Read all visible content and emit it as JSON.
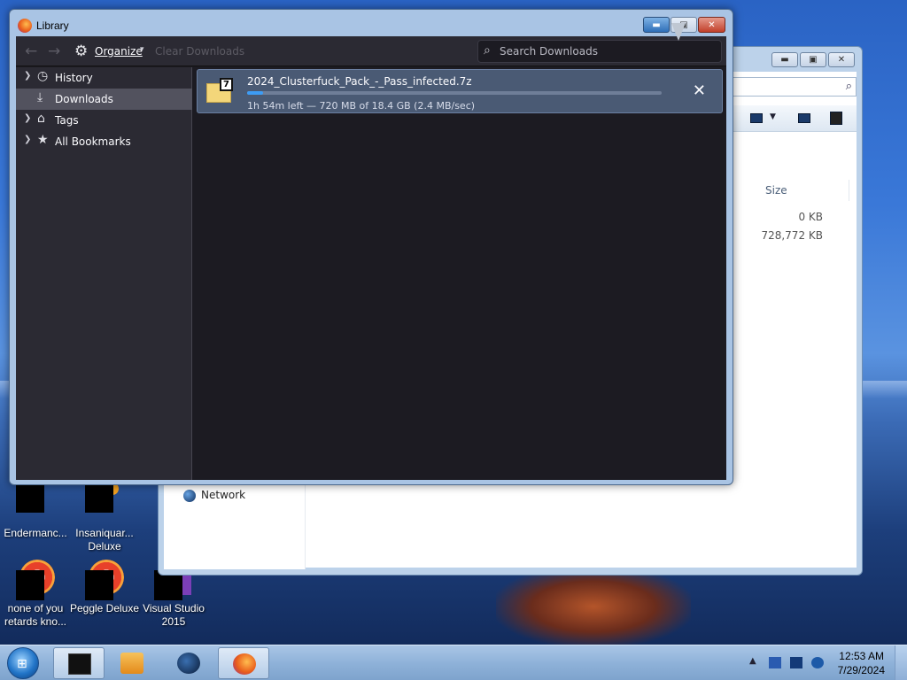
{
  "library": {
    "title": "Library",
    "toolbar": {
      "organize_label": "Organize",
      "clear_label": "Clear Downloads",
      "search_placeholder": "Search Downloads"
    },
    "sidebar": {
      "items": [
        {
          "label": "History",
          "icon": "clock-icon",
          "expandable": true,
          "selected": false
        },
        {
          "label": "Downloads",
          "icon": "download-icon",
          "expandable": false,
          "selected": true
        },
        {
          "label": "Tags",
          "icon": "tag-icon",
          "expandable": true,
          "selected": false
        },
        {
          "label": "All Bookmarks",
          "icon": "star-icon",
          "expandable": true,
          "selected": false
        }
      ]
    },
    "downloads": [
      {
        "filename": "2024_Clusterfuck_Pack_-_Pass_infected.7z",
        "progress": 0.039,
        "status": "1h 54m left — 720 MB of 18.4 GB (2.4 MB/sec)",
        "icon_badge": "7"
      }
    ]
  },
  "explorer": {
    "column_header": "Size",
    "sizes": [
      "0 KB",
      "728,772 KB"
    ],
    "nav_item": "Network"
  },
  "desktop_icons": [
    {
      "label_line1": "Endermanc...",
      "label_line2": ""
    },
    {
      "label_line1": "Insaniquar...",
      "label_line2": "Deluxe"
    },
    {
      "label_line1": "none of you",
      "label_line2": "retards kno..."
    },
    {
      "label_line1": "Peggle Deluxe",
      "label_line2": ""
    },
    {
      "label_line1": "Visual Studio",
      "label_line2": "2015"
    }
  ],
  "taskbar": {
    "time": "12:53 AM",
    "date": "7/29/2024"
  },
  "colors": {
    "accent": "#3d9cf5",
    "library_bg": "#1c1b22",
    "sidebar_bg": "#2b2a33"
  }
}
